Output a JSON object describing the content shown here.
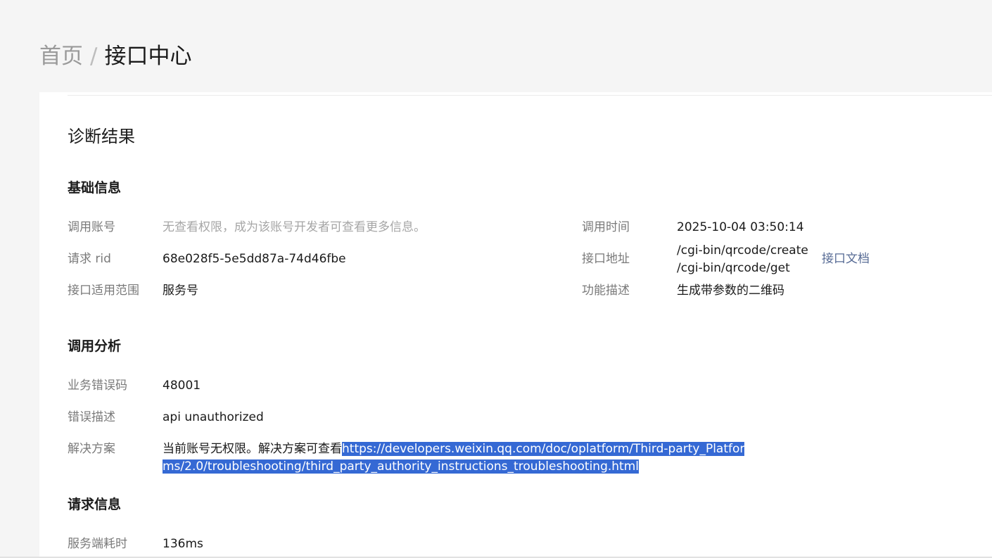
{
  "breadcrumb": {
    "home": "首页",
    "separator": "/",
    "current": "接口中心"
  },
  "card": {
    "title": "诊断结果"
  },
  "basic_info": {
    "title": "基础信息",
    "caller_account_label": "调用账号",
    "caller_account_value": "无查看权限，成为该账号开发者可查看更多信息。",
    "call_time_label": "调用时间",
    "call_time_value": "2025-10-04 03:50:14",
    "request_rid_label": "请求 rid",
    "request_rid_value": "68e028f5-5e5dd87a-74d46fbe",
    "api_address_label": "接口地址",
    "api_address_values": [
      "/cgi-bin/qrcode/create",
      "/cgi-bin/qrcode/get"
    ],
    "api_doc_link": "接口文档",
    "scope_label": "接口适用范围",
    "scope_value": "服务号",
    "function_label": "功能描述",
    "function_value": "生成带参数的二维码"
  },
  "call_analysis": {
    "title": "调用分析",
    "error_code_label": "业务错误码",
    "error_code_value": "48001",
    "error_desc_label": "错误描述",
    "error_desc_value": "api unauthorized",
    "solution_label": "解决方案",
    "solution_text": "当前账号无权限。解决方案可查看",
    "solution_url": "https://developers.weixin.qq.com/doc/oplatform/Third-party_Platforms/2.0/troubleshooting/third_party_authority_instructions_troubleshooting.html"
  },
  "request_info": {
    "title": "请求信息",
    "server_time_label": "服务端耗时",
    "server_time_value": "136ms"
  },
  "colors": {
    "link": "#576b95",
    "selection": "#3569d4",
    "page_background": "#f5f5f5"
  }
}
